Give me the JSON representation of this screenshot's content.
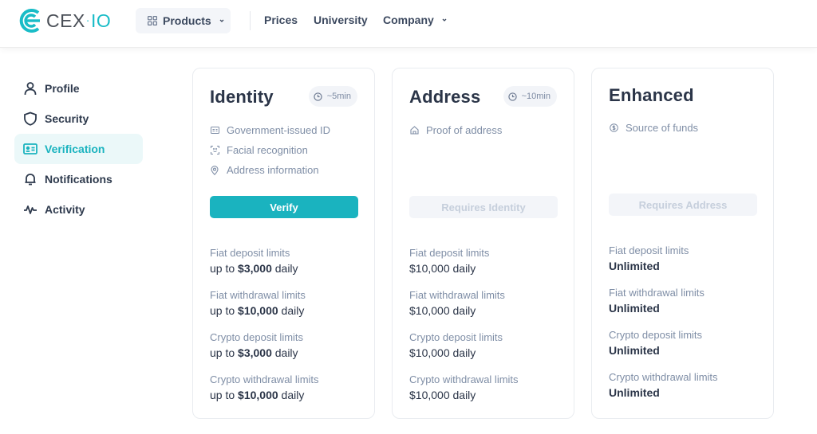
{
  "header": {
    "logo": {
      "text_main": "CEX",
      "text_dot": "·",
      "text_io": "IO"
    },
    "products": {
      "label": "Products",
      "icon": "grid-icon"
    },
    "nav": [
      {
        "label": "Prices",
        "has_dropdown": false
      },
      {
        "label": "University",
        "has_dropdown": false
      },
      {
        "label": "Company",
        "has_dropdown": true
      }
    ]
  },
  "sidebar": {
    "items": [
      {
        "label": "Profile",
        "icon": "user-icon",
        "active": false
      },
      {
        "label": "Security",
        "icon": "shield-icon",
        "active": false
      },
      {
        "label": "Verification",
        "icon": "id-card-icon",
        "active": true
      },
      {
        "label": "Notifications",
        "icon": "bell-icon",
        "active": false
      },
      {
        "label": "Activity",
        "icon": "activity-icon",
        "active": false
      }
    ]
  },
  "cards": [
    {
      "title": "Identity",
      "time": "~5min",
      "requirements": [
        {
          "label": "Government-issued ID",
          "icon": "id-card-icon"
        },
        {
          "label": "Facial recognition",
          "icon": "face-scan-icon"
        },
        {
          "label": "Address information",
          "icon": "location-pin-icon"
        }
      ],
      "button": {
        "label": "Verify",
        "enabled": true
      },
      "limits": [
        {
          "label": "Fiat deposit limits",
          "prefix": "up to ",
          "amount": "$3,000",
          "suffix": " daily"
        },
        {
          "label": "Fiat withdrawal limits",
          "prefix": "up to ",
          "amount": "$10,000",
          "suffix": " daily"
        },
        {
          "label": "Crypto deposit limits",
          "prefix": "up to ",
          "amount": "$3,000",
          "suffix": " daily"
        },
        {
          "label": "Crypto withdrawal limits",
          "prefix": "up to ",
          "amount": "$10,000",
          "suffix": " daily"
        }
      ]
    },
    {
      "title": "Address",
      "time": "~10min",
      "requirements": [
        {
          "label": "Proof of address",
          "icon": "home-icon"
        }
      ],
      "button": {
        "label": "Requires Identity",
        "enabled": false
      },
      "limits": [
        {
          "label": "Fiat deposit limits",
          "value": "$10,000 daily"
        },
        {
          "label": "Fiat withdrawal limits",
          "value": "$10,000 daily"
        },
        {
          "label": "Crypto deposit limits",
          "value": "$10,000 daily"
        },
        {
          "label": "Crypto withdrawal limits",
          "value": "$10,000 daily"
        }
      ]
    },
    {
      "title": "Enhanced",
      "requirements": [
        {
          "label": "Source of funds",
          "icon": "dollar-coin-icon"
        }
      ],
      "button": {
        "label": "Requires Address",
        "enabled": false
      },
      "limits": [
        {
          "label": "Fiat deposit limits",
          "value": "Unlimited"
        },
        {
          "label": "Fiat withdrawal limits",
          "value": "Unlimited"
        },
        {
          "label": "Crypto deposit limits",
          "value": "Unlimited"
        },
        {
          "label": "Crypto withdrawal limits",
          "value": "Unlimited"
        }
      ]
    }
  ],
  "colors": {
    "accent": "#1ab3bf",
    "text_dark": "#2b3548",
    "text_muted": "#7f8ea6",
    "active_bg": "#ebf8f9"
  }
}
